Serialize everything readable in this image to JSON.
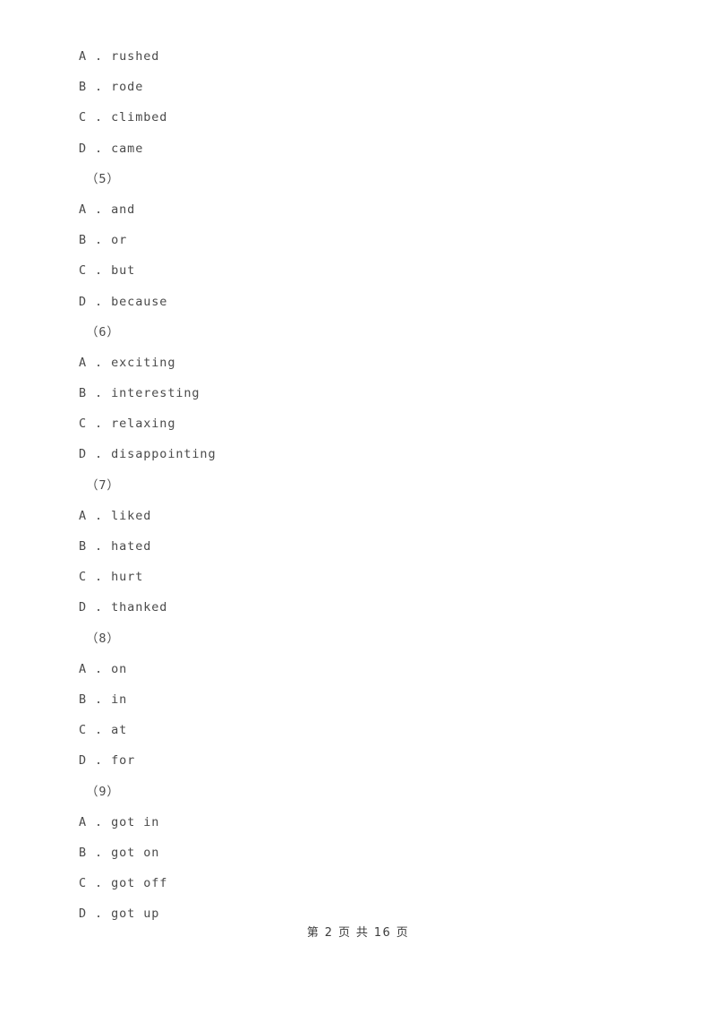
{
  "document": {
    "page_background": "#ffffff",
    "text_color": "#4a4a4a",
    "blocks": [
      {
        "kind": "options",
        "options": [
          {
            "letter": "A",
            "separator": " . ",
            "text": "rushed"
          },
          {
            "letter": "B",
            "separator": " . ",
            "text": "rode"
          },
          {
            "letter": "C",
            "separator": " . ",
            "text": "climbed"
          },
          {
            "letter": "D",
            "separator": " . ",
            "text": "came"
          }
        ]
      },
      {
        "kind": "question_number",
        "label": "（5）"
      },
      {
        "kind": "options",
        "options": [
          {
            "letter": "A",
            "separator": " . ",
            "text": "and"
          },
          {
            "letter": "B",
            "separator": " . ",
            "text": "or"
          },
          {
            "letter": "C",
            "separator": " . ",
            "text": "but"
          },
          {
            "letter": "D",
            "separator": " . ",
            "text": "because"
          }
        ]
      },
      {
        "kind": "question_number",
        "label": "（6）"
      },
      {
        "kind": "options",
        "options": [
          {
            "letter": "A",
            "separator": " . ",
            "text": "exciting"
          },
          {
            "letter": "B",
            "separator": " . ",
            "text": "interesting"
          },
          {
            "letter": "C",
            "separator": " . ",
            "text": "relaxing"
          },
          {
            "letter": "D",
            "separator": " . ",
            "text": "disappointing"
          }
        ]
      },
      {
        "kind": "question_number",
        "label": "（7）"
      },
      {
        "kind": "options",
        "options": [
          {
            "letter": "A",
            "separator": " . ",
            "text": "liked"
          },
          {
            "letter": "B",
            "separator": " . ",
            "text": "hated"
          },
          {
            "letter": "C",
            "separator": " . ",
            "text": "hurt"
          },
          {
            "letter": "D",
            "separator": " . ",
            "text": "thanked"
          }
        ]
      },
      {
        "kind": "question_number",
        "label": "（8）"
      },
      {
        "kind": "options",
        "options": [
          {
            "letter": "A",
            "separator": " . ",
            "text": "on"
          },
          {
            "letter": "B",
            "separator": " . ",
            "text": "in"
          },
          {
            "letter": "C",
            "separator": " . ",
            "text": "at"
          },
          {
            "letter": "D",
            "separator": " . ",
            "text": "for"
          }
        ]
      },
      {
        "kind": "question_number",
        "label": "（9）"
      },
      {
        "kind": "options",
        "options": [
          {
            "letter": "A",
            "separator": " . ",
            "text": "got in"
          },
          {
            "letter": "B",
            "separator": " . ",
            "text": "got on"
          },
          {
            "letter": "C",
            "separator": " . ",
            "text": "got off"
          },
          {
            "letter": "D",
            "separator": " . ",
            "text": "got up"
          }
        ]
      }
    ]
  },
  "footer": {
    "text": "第 2 页 共 16 页",
    "current_page": "2",
    "total_pages": "16"
  }
}
